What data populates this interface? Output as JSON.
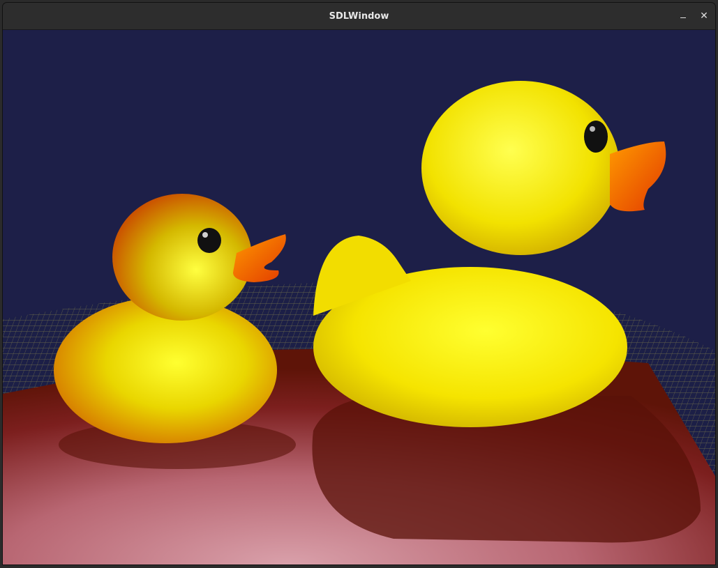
{
  "window": {
    "title": "SDLWindow"
  },
  "controls": {
    "minimize_icon": "minimize-icon",
    "close_glyph": "✕"
  },
  "scene": {
    "background_color": "#1d1f48",
    "grid_color": "#c9c450",
    "floor_color": "#a1434a",
    "duck_color": "#f2e000"
  }
}
